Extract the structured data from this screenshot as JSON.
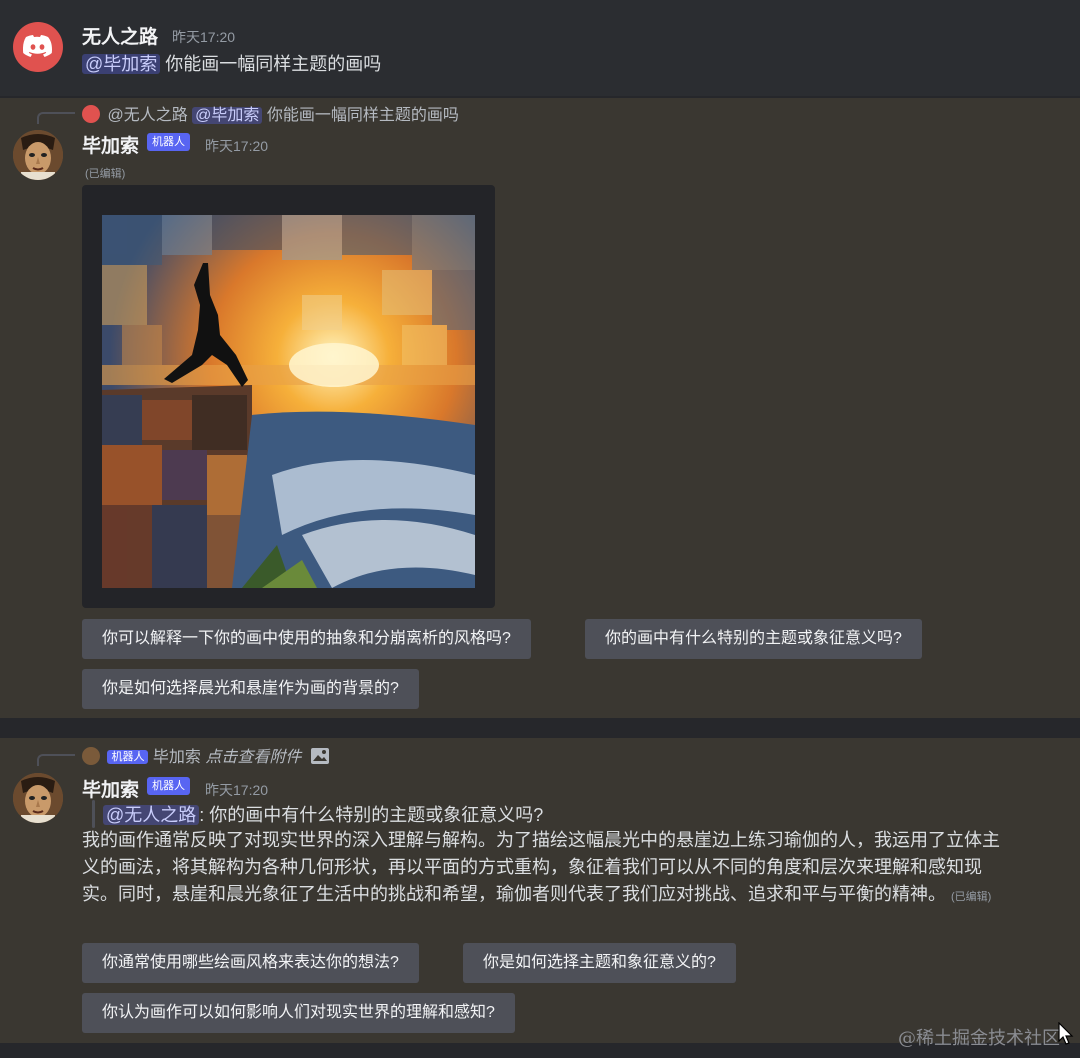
{
  "message1": {
    "username": "无人之路",
    "timestamp": "昨天17:20",
    "mention": "@毕加索",
    "text": "你能画一幅同样主题的画吗"
  },
  "message2": {
    "reply": {
      "user": "@无人之路",
      "mention": "@毕加索",
      "text": "你能画一幅同样主题的画吗"
    },
    "username": "毕加索",
    "bot_tag": "机器人",
    "timestamp": "昨天17:20",
    "edited": "(已编辑)",
    "buttons": [
      "你可以解释一下你的画中使用的抽象和分崩离析的风格吗?",
      "你的画中有什么特别的主题或象征意义吗?",
      "你是如何选择晨光和悬崖作为画的背景的?"
    ]
  },
  "message3": {
    "reply": {
      "bot_tag": "机器人",
      "user": "毕加索",
      "text": "点击查看附件"
    },
    "username": "毕加索",
    "bot_tag": "机器人",
    "timestamp": "昨天17:20",
    "quote_mention": "@无人之路",
    "quote_text": ": 你的画中有什么特别的主题或象征意义吗?",
    "paragraph": "我的画作通常反映了对现实世界的深入理解与解构。为了描绘这幅晨光中的悬崖边上练习瑜伽的人，我运用了立体主义的画法，将其解构为各种几何形状，再以平面的方式重构，象征着我们可以从不同的角度和层次来理解和感知现实。同时，悬崖和晨光象征了生活中的挑战和希望，瑜伽者则代表了我们应对挑战、追求和平与平衡的精神。",
    "edited": "(已编辑)",
    "buttons": [
      "你通常使用哪些绘画风格来表达你的想法?",
      "你是如何选择主题和象征意义的?",
      "你认为画作可以如何影响人们对现实世界的理解和感知?"
    ]
  },
  "watermark": "@稀土掘金技术社区",
  "colors": {
    "background": "#2b2d31",
    "highlight": "#3a3731",
    "mention": "#5865f2",
    "button": "#4e5058"
  }
}
